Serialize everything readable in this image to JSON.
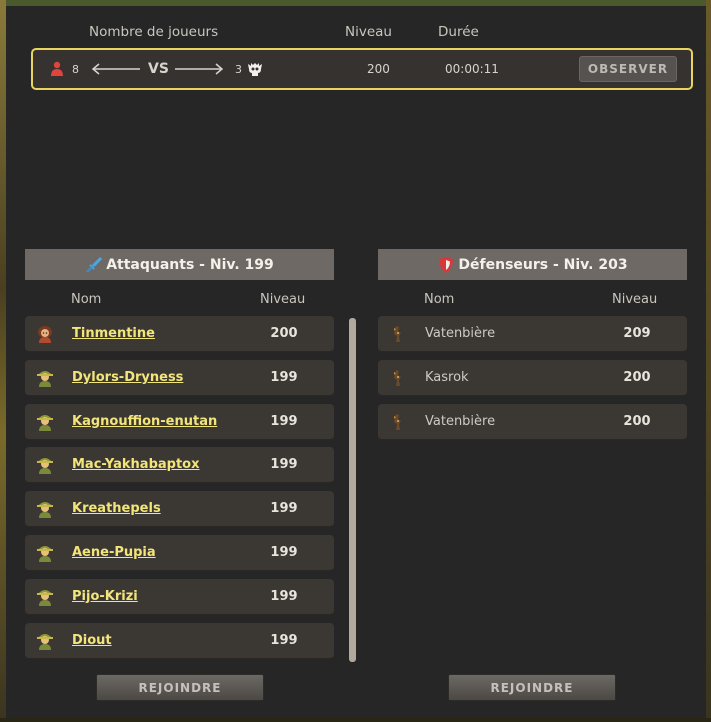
{
  "header": {
    "players_label": "Nombre de joueurs",
    "level_label": "Niveau",
    "duration_label": "Durée"
  },
  "fight": {
    "attackers_count": "8",
    "vs": "VS",
    "defenders_count": "3",
    "level": "200",
    "duration": "00:00:11",
    "observe_label": "OBSERVER"
  },
  "attackers": {
    "title": "Attaquants - Niv. 199",
    "col_name": "Nom",
    "col_level": "Niveau",
    "join_label": "REJOINDRE",
    "rows": [
      {
        "name": "Tinmentine",
        "level": "200",
        "avatar": "female-character-avatar"
      },
      {
        "name": "Dylors-Dryness",
        "level": "199",
        "avatar": "character-avatar"
      },
      {
        "name": "Kagnouffion-enutan",
        "level": "199",
        "avatar": "character-avatar"
      },
      {
        "name": "Mac-Yakhabaptox",
        "level": "199",
        "avatar": "character-avatar"
      },
      {
        "name": "Kreathepels",
        "level": "199",
        "avatar": "character-avatar"
      },
      {
        "name": "Aene-Pupia",
        "level": "199",
        "avatar": "character-avatar"
      },
      {
        "name": "Pijo-Krizi",
        "level": "199",
        "avatar": "character-avatar"
      },
      {
        "name": "Diout",
        "level": "199",
        "avatar": "character-avatar"
      }
    ]
  },
  "defenders": {
    "title": "Défenseurs - Niv. 203",
    "col_name": "Nom",
    "col_level": "Niveau",
    "join_label": "REJOINDRE",
    "rows": [
      {
        "name": "Vatenbière",
        "level": "209",
        "avatar": "monster-avatar"
      },
      {
        "name": "Kasrok",
        "level": "200",
        "avatar": "monster-avatar"
      },
      {
        "name": "Vatenbière",
        "level": "200",
        "avatar": "monster-avatar"
      }
    ]
  },
  "colors": {
    "highlight_border": "#e8d45e",
    "attacker_name": "#f2e57a",
    "panel_bg": "#262626",
    "row_bg": "#3b3733",
    "team_header_bg": "#6e6964"
  }
}
